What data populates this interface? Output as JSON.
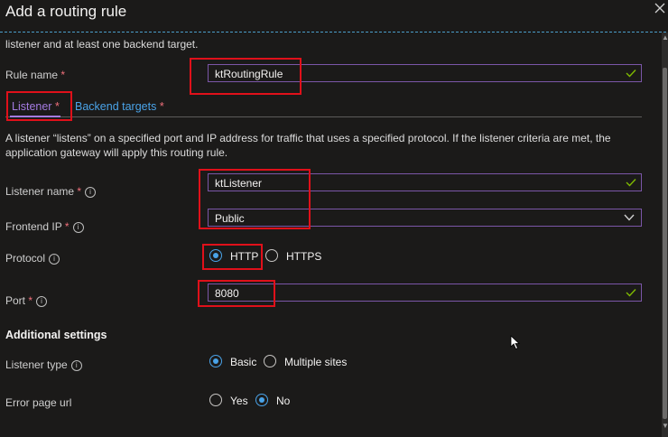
{
  "panel": {
    "title": "Add a routing rule",
    "intro_text": "listener and at least one backend target."
  },
  "rule_name": {
    "label": "Rule name",
    "required_mark": "*",
    "value": "ktRoutingRule"
  },
  "tabs": [
    {
      "label": "Listener",
      "required_mark": "*",
      "active": true
    },
    {
      "label": "Backend targets",
      "required_mark": "*",
      "active": false
    }
  ],
  "listener": {
    "description_line1": "A listener “listens” on a specified port and IP address for traffic that uses a specified protocol. If the listener criteria are met, the",
    "description_line2": "application gateway will apply this routing rule.",
    "listener_name": {
      "label": "Listener name",
      "required_mark": "*",
      "value": "ktListener"
    },
    "frontend_ip": {
      "label": "Frontend IP",
      "required_mark": "*",
      "selected": "Public"
    },
    "protocol": {
      "label": "Protocol",
      "options": [
        "HTTP",
        "HTTPS"
      ],
      "selected": "HTTP"
    },
    "port": {
      "label": "Port",
      "required_mark": "*",
      "value": "8080"
    }
  },
  "additional_settings": {
    "heading": "Additional settings",
    "listener_type": {
      "label": "Listener type",
      "options": [
        "Basic",
        "Multiple sites"
      ],
      "selected": "Basic"
    },
    "error_page_url": {
      "label": "Error page url",
      "options": [
        "Yes",
        "No"
      ],
      "selected": "No"
    }
  },
  "colors": {
    "background": "#1b1a19",
    "accent_purple": "#a47be0",
    "link_blue": "#4aa3e8",
    "valid_green": "#7fba00",
    "highlight_red": "#e0101a",
    "required_red": "#f1707b"
  },
  "icons": [
    "close-icon",
    "checkmark-icon",
    "chevron-down-icon",
    "info-icon"
  ]
}
